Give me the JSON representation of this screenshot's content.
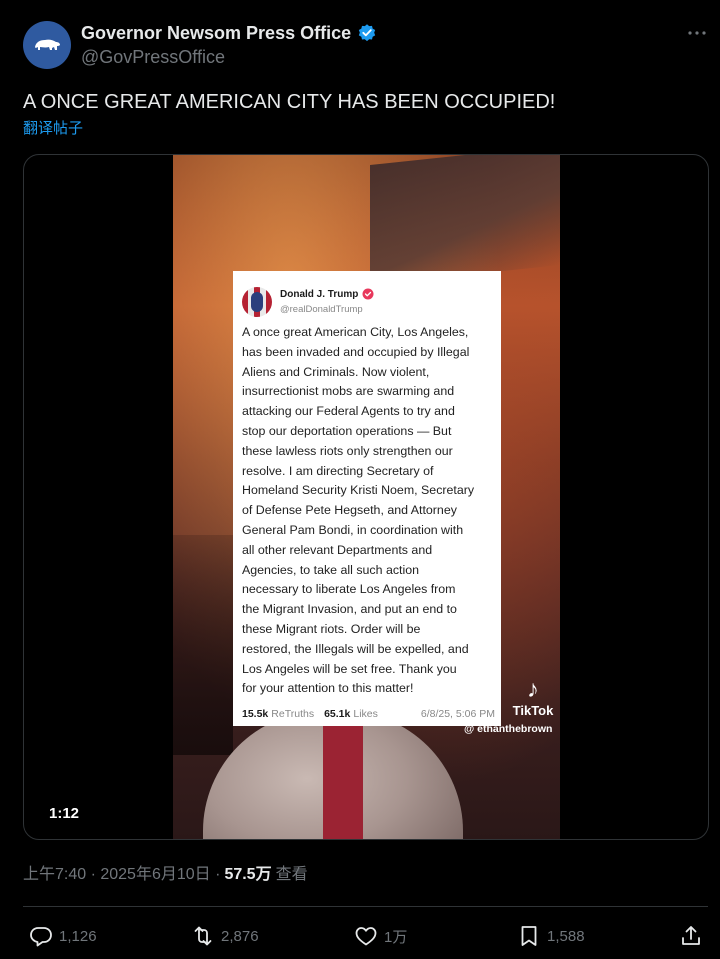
{
  "author": {
    "display_name": "Governor Newsom Press Office",
    "handle": "@GovPressOffice",
    "verified_icon": "verified-badge-icon",
    "avatar_icon": "california-bear-icon"
  },
  "post": {
    "text": "A ONCE GREAT AMERICAN CITY HAS BEEN OCCUPIED!",
    "translate_label": "翻译帖子"
  },
  "video": {
    "duration": "1:12",
    "embedded_post": {
      "name": "Donald J. Trump",
      "handle": "@realDonaldTrump",
      "body": "A once great American City, Los Angeles,\nhas been invaded and occupied by Illegal\nAliens and Criminals.  Now violent,\ninsurrectionist mobs are swarming and\nattacking our Federal Agents to try and\nstop our deportation operations — But\nthese lawless riots only strengthen our\nresolve. I am directing Secretary of\nHomeland Security Kristi Noem, Secretary\nof Defense Pete Hegseth, and Attorney\nGeneral Pam Bondi, in coordination with\nall other relevant Departments and\nAgencies, to take all such action\nnecessary to liberate Los Angeles from\nthe Migrant Invasion, and put an end to\nthese Migrant riots. Order will be\nrestored, the Illegals will be expelled, and\nLos Angeles will be set free. Thank you\nfor your attention to this matter!",
      "retruths_count": "15.5k",
      "retruths_label": "ReTruths",
      "likes_count": "65.1k",
      "likes_label": "Likes",
      "date": "6/8/25, 5:06 PM"
    },
    "watermark": {
      "brand": "TikTok",
      "user": "@ ethanthebrown"
    }
  },
  "meta": {
    "time_date": "上午7:40 · 2025年6月10日 ·",
    "views": "57.5万",
    "views_label": "查看"
  },
  "actions": {
    "replies": "1,126",
    "reposts": "2,876",
    "likes": "1万",
    "bookmarks": "1,588"
  },
  "colors": {
    "accent": "#1d9bf0",
    "muted": "#71767b",
    "text": "#e7e9ea",
    "background": "#000000"
  }
}
